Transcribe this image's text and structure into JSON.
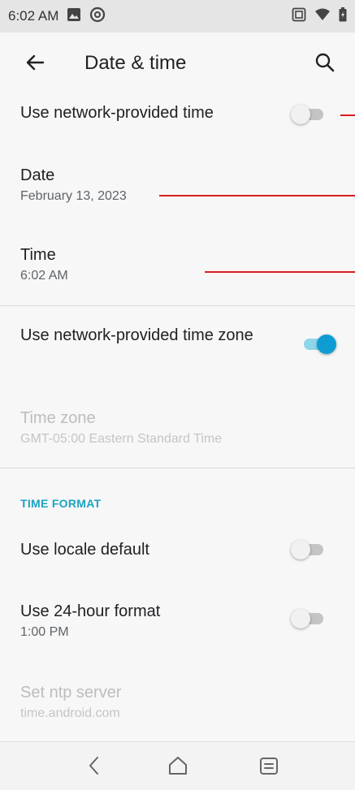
{
  "status_bar": {
    "time": "6:02 AM",
    "left_icons": [
      "image-icon",
      "at-icon"
    ],
    "right_icons": [
      "sim-icon",
      "wifi-icon",
      "battery-icon"
    ]
  },
  "app_bar": {
    "title": "Date & time",
    "back_icon": "arrow-left-icon",
    "search_icon": "search-icon"
  },
  "settings": {
    "network_time": {
      "label": "Use network-provided time",
      "enabled": false
    },
    "date": {
      "label": "Date",
      "value": "February 13, 2023"
    },
    "time": {
      "label": "Time",
      "value": "6:02 AM"
    },
    "network_timezone": {
      "label": "Use network-provided time zone",
      "enabled": true
    },
    "time_zone": {
      "label": "Time zone",
      "value": "GMT-05:00 Eastern Standard Time",
      "disabled": true
    }
  },
  "time_format": {
    "header": "TIME FORMAT",
    "locale_default": {
      "label": "Use locale default",
      "enabled": false
    },
    "format_24h": {
      "label": "Use 24-hour format",
      "value": "1:00 PM",
      "enabled": false
    },
    "ntp_server": {
      "label": "Set ntp server",
      "value": "time.android.com",
      "disabled": true
    }
  },
  "nav_bar": {
    "icons": [
      "back-nav-icon",
      "home-nav-icon",
      "recents-nav-icon"
    ]
  },
  "colors": {
    "accent": "#0e9dd3",
    "section_header": "#1aa3c4",
    "annotation_line": "#d91f1f"
  }
}
